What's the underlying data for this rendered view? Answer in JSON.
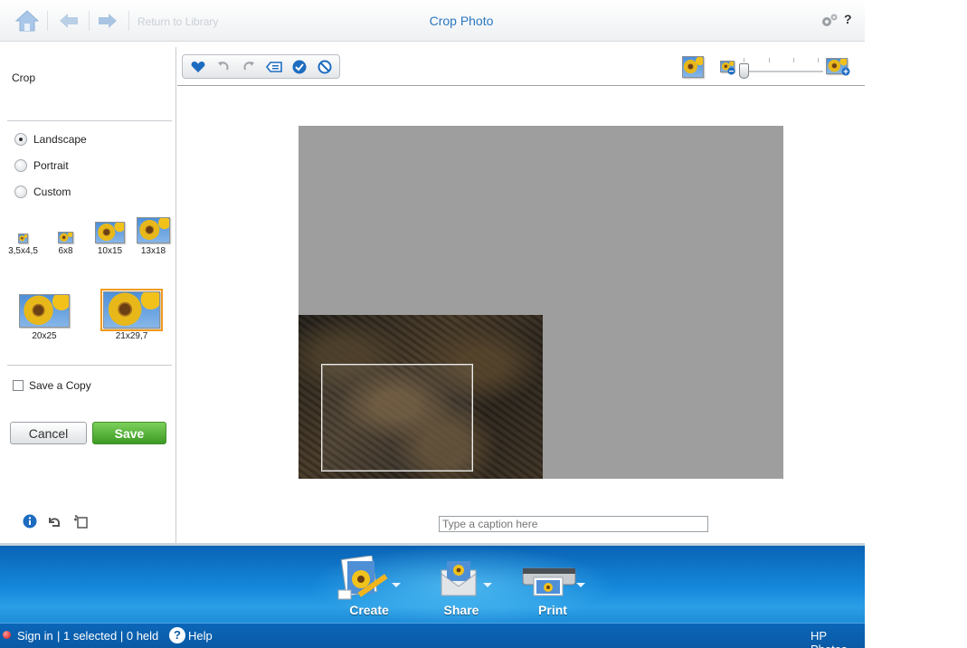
{
  "header": {
    "back_link": "Return to Library",
    "title": "Crop Photo",
    "help": "?"
  },
  "left_panel": {
    "title": "Crop",
    "orientation": [
      {
        "label": "Landscape",
        "checked": true
      },
      {
        "label": "Portrait",
        "checked": false
      },
      {
        "label": "Custom",
        "checked": false
      }
    ],
    "sizes": [
      "3,5x4,5",
      "6x8",
      "10x15",
      "13x18",
      "20x25",
      "21x29,7"
    ],
    "selected_size": "21x29,7",
    "save_copy_label": "Save a Copy",
    "save_copy_checked": false,
    "cancel_label": "Cancel",
    "save_label": "Save"
  },
  "caption": {
    "placeholder": "Type a caption here"
  },
  "actions": [
    {
      "label": "Create"
    },
    {
      "label": "Share"
    },
    {
      "label": "Print"
    }
  ],
  "status": {
    "sign_in": "Sign in",
    "selection": "| 1 selected | 0 held",
    "help": "Help",
    "help_glyph": "?",
    "brand": "HP Photos"
  },
  "colors": {
    "accent": "#2a78c0",
    "save_green": "#3c9a23",
    "bottom_blue": "#1487da",
    "selected_outline": "#f09a1d"
  }
}
